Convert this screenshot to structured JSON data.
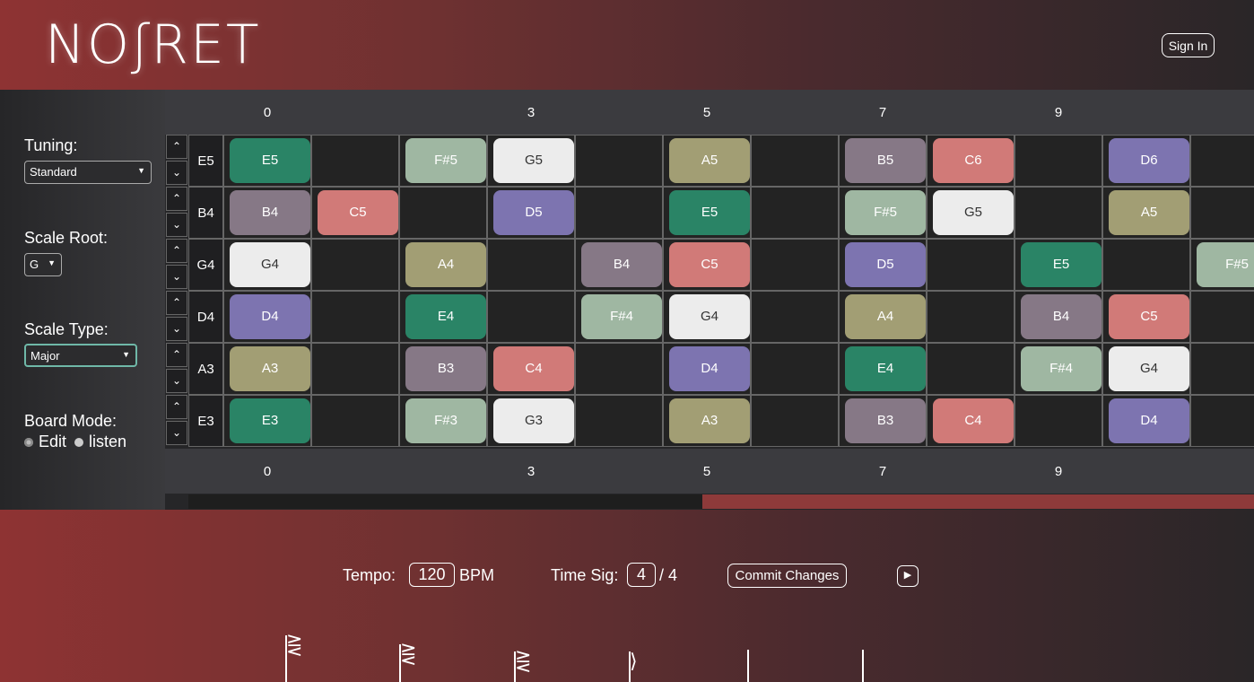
{
  "header": {
    "logo_text": "NOʃRET",
    "signin_label": "Sign In"
  },
  "sidebar": {
    "tuning_label": "Tuning:",
    "tuning_value": "Standard",
    "root_label": "Scale Root:",
    "root_value": "G",
    "type_label": "Scale Type:",
    "type_value": "Major",
    "mode_label": "Board Mode:",
    "mode_options": [
      "Edit",
      "listen"
    ]
  },
  "fret_numbers": [
    "0",
    "3",
    "5",
    "7",
    "9"
  ],
  "board": {
    "strings": [
      {
        "name": "E5",
        "notes": [
          "E5",
          "",
          "F#5",
          "G5",
          "",
          "A5",
          "",
          "B5",
          "C6",
          "",
          "D6",
          ""
        ]
      },
      {
        "name": "B4",
        "notes": [
          "B4",
          "C5",
          "",
          "D5",
          "",
          "E5",
          "",
          "F#5",
          "G5",
          "",
          "A5",
          ""
        ]
      },
      {
        "name": "G4",
        "notes": [
          "G4",
          "",
          "A4",
          "",
          "B4",
          "C5",
          "",
          "D5",
          "",
          "E5",
          "",
          "F#5"
        ]
      },
      {
        "name": "D4",
        "notes": [
          "D4",
          "",
          "E4",
          "",
          "F#4",
          "G4",
          "",
          "A4",
          "",
          "B4",
          "C5",
          ""
        ]
      },
      {
        "name": "A3",
        "notes": [
          "A3",
          "",
          "B3",
          "C4",
          "",
          "D4",
          "",
          "E4",
          "",
          "F#4",
          "G4",
          ""
        ]
      },
      {
        "name": "E3",
        "notes": [
          "E3",
          "",
          "F#3",
          "G3",
          "",
          "A3",
          "",
          "B3",
          "C4",
          "",
          "D4",
          ""
        ]
      }
    ]
  },
  "note_colors": {
    "C": "#d17a78",
    "D": "#7d74b0",
    "E": "#2a8466",
    "F#": "#9fb7a2",
    "G": "#ececec",
    "A": "#a29e74",
    "B": "#867886"
  },
  "footer": {
    "tempo_label": "Tempo:",
    "tempo_value": "120",
    "tempo_unit": "BPM",
    "timesig_label": "Time Sig:",
    "timesig_top": "4",
    "timesig_bottom": "/ 4",
    "commit_label": "Commit Changes",
    "play_icon": "play-icon"
  }
}
